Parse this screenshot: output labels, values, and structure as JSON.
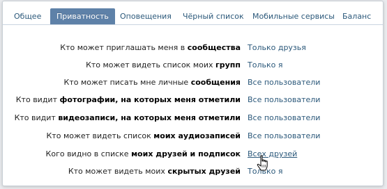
{
  "tabs": [
    {
      "label": "Общее"
    },
    {
      "label": "Приватность",
      "active": true
    },
    {
      "label": "Оповещения"
    },
    {
      "label": "Чёрный список"
    },
    {
      "label": "Мобильные сервисы"
    },
    {
      "label": "Баланс"
    }
  ],
  "settings": [
    {
      "prefix": "Кто может приглашать меня в ",
      "bold": "сообщества",
      "value": "Только друзья"
    },
    {
      "prefix": "Кто может видеть список моих ",
      "bold": "групп",
      "value": "Только я"
    },
    {
      "prefix": "Кто может писать мне личные ",
      "bold": "сообщения",
      "value": "Все пользователи"
    },
    {
      "prefix": "Кто видит ",
      "bold": "фотографии, на которых меня отметили",
      "value": "Все пользователи"
    },
    {
      "prefix": "Кто видит ",
      "bold": "видеозаписи, на которых меня отметили",
      "value": "Все пользователи"
    },
    {
      "prefix": "Кто может видеть список ",
      "bold": "моих аудиозаписей",
      "value": "Все пользователи"
    },
    {
      "prefix": "Кого видно в списке ",
      "bold": "моих друзей и подписок",
      "value": "Всех друзей"
    },
    {
      "prefix": "Кто может видеть моих ",
      "bold": "скрытых друзей",
      "value": "Только я"
    }
  ],
  "colors": {
    "link": "#2b587a",
    "active_tab_bg": "#5e81a8",
    "active_tab_text": "#ffffff"
  },
  "icons": {
    "cursor": "hand-pointer-icon"
  }
}
